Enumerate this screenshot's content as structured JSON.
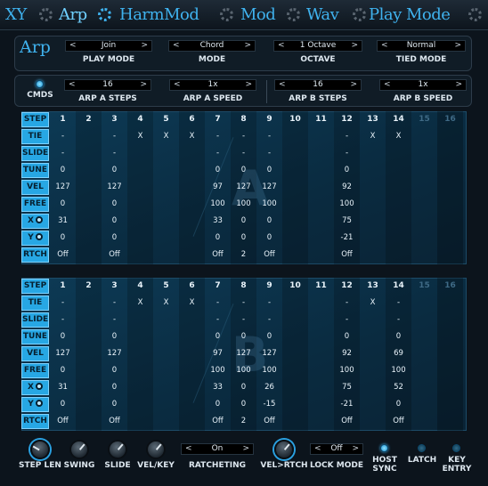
{
  "tabs": [
    {
      "label": "XY",
      "active": false
    },
    {
      "label": "Arp",
      "active": true
    },
    {
      "label": "HarmMod",
      "active": false
    },
    {
      "label": "Mod",
      "active": false
    },
    {
      "label": "Wav",
      "active": false
    },
    {
      "label": "Play Mode",
      "active": false
    }
  ],
  "arp": {
    "title": "Arp",
    "play_mode": {
      "label": "PLAY MODE",
      "value": "Join"
    },
    "mode": {
      "label": "MODE",
      "value": "Chord"
    },
    "octave": {
      "label": "OCTAVE",
      "value": "1 Octave"
    },
    "tied_mode": {
      "label": "TIED MODE",
      "value": "Normal"
    },
    "cmds_label": "CMDS",
    "arp_a_steps": {
      "label": "ARP A STEPS",
      "value": "16"
    },
    "arp_a_speed": {
      "label": "ARP A SPEED",
      "value": "1x"
    },
    "arp_b_steps": {
      "label": "ARP B STEPS",
      "value": "16"
    },
    "arp_b_speed": {
      "label": "ARP B SPEED",
      "value": "1x"
    },
    "arrow_left": "<",
    "arrow_right": ">"
  },
  "grid_a": {
    "letter": "A",
    "row_labels": [
      "STEP",
      "TIE",
      "SLIDE",
      "TUNE",
      "VEL",
      "FREE",
      "X",
      "Y",
      "RTCH"
    ],
    "active_steps": 14,
    "rows": [
      [
        "1",
        "2",
        "3",
        "4",
        "5",
        "6",
        "7",
        "8",
        "9",
        "10",
        "11",
        "12",
        "13",
        "14",
        "15",
        "16"
      ],
      [
        "-",
        "",
        "-",
        "X",
        "X",
        "X",
        "-",
        "-",
        "-",
        "",
        "",
        "-",
        "X",
        "X",
        "",
        ""
      ],
      [
        "-",
        "",
        "-",
        "",
        "",
        "",
        "-",
        "-",
        "-",
        "",
        "",
        "-",
        "",
        "",
        "",
        ""
      ],
      [
        "0",
        "",
        "0",
        "",
        "",
        "",
        "0",
        "0",
        "0",
        "",
        "",
        "0",
        "",
        "",
        "",
        ""
      ],
      [
        "127",
        "",
        "127",
        "",
        "",
        "",
        "97",
        "127",
        "127",
        "",
        "",
        "92",
        "",
        "",
        "",
        ""
      ],
      [
        "0",
        "",
        "0",
        "",
        "",
        "",
        "100",
        "100",
        "100",
        "",
        "",
        "100",
        "",
        "",
        "",
        ""
      ],
      [
        "31",
        "",
        "0",
        "",
        "",
        "",
        "33",
        "0",
        "0",
        "",
        "",
        "75",
        "",
        "",
        "",
        ""
      ],
      [
        "0",
        "",
        "0",
        "",
        "",
        "",
        "0",
        "0",
        "0",
        "",
        "",
        "-21",
        "",
        "",
        "",
        ""
      ],
      [
        "Off",
        "",
        "Off",
        "",
        "",
        "",
        "Off",
        "2",
        "Off",
        "",
        "",
        "Off",
        "",
        "",
        "",
        ""
      ]
    ]
  },
  "grid_b": {
    "letter": "B",
    "row_labels": [
      "STEP",
      "TIE",
      "SLIDE",
      "TUNE",
      "VEL",
      "FREE",
      "X",
      "Y",
      "RTCH"
    ],
    "active_steps": 14,
    "rows": [
      [
        "1",
        "2",
        "3",
        "4",
        "5",
        "6",
        "7",
        "8",
        "9",
        "10",
        "11",
        "12",
        "13",
        "14",
        "15",
        "16"
      ],
      [
        "-",
        "",
        "-",
        "X",
        "X",
        "X",
        "-",
        "-",
        "-",
        "",
        "",
        "-",
        "X",
        "-",
        "",
        ""
      ],
      [
        "-",
        "",
        "-",
        "",
        "",
        "",
        "-",
        "-",
        "-",
        "",
        "",
        "-",
        "",
        "-",
        "",
        ""
      ],
      [
        "0",
        "",
        "0",
        "",
        "",
        "",
        "0",
        "0",
        "0",
        "",
        "",
        "0",
        "",
        "0",
        "",
        ""
      ],
      [
        "127",
        "",
        "127",
        "",
        "",
        "",
        "97",
        "127",
        "127",
        "",
        "",
        "92",
        "",
        "69",
        "",
        ""
      ],
      [
        "0",
        "",
        "0",
        "",
        "",
        "",
        "100",
        "100",
        "100",
        "",
        "",
        "100",
        "",
        "100",
        "",
        ""
      ],
      [
        "31",
        "",
        "0",
        "",
        "",
        "",
        "33",
        "0",
        "26",
        "",
        "",
        "75",
        "",
        "52",
        "",
        ""
      ],
      [
        "0",
        "",
        "0",
        "",
        "",
        "",
        "0",
        "0",
        "-15",
        "",
        "",
        "-21",
        "",
        "0",
        "",
        ""
      ],
      [
        "Off",
        "",
        "Off",
        "",
        "",
        "",
        "Off",
        "2",
        "Off",
        "",
        "",
        "Off",
        "",
        "Off",
        "",
        ""
      ]
    ]
  },
  "bottom": {
    "step_len": "STEP LEN",
    "swing": "SWING",
    "slide": "SLIDE",
    "vel_key": "VEL/KEY",
    "ratcheting": {
      "label": "RATCHETING",
      "value": "On"
    },
    "vel_rtch": "VEL>RTCH",
    "lock_mode": {
      "label": "LOCK MODE",
      "value": "Off"
    },
    "host_sync": {
      "label_1": "HOST",
      "label_2": "SYNC",
      "on": true
    },
    "latch": {
      "label": "LATCH",
      "on": false
    },
    "key_entry": {
      "label_1": "KEY",
      "label_2": "ENTRY",
      "on": false
    }
  },
  "colors": {
    "accent": "#3fb2ee",
    "grid_bg": "#0a2b40",
    "row_label_bg": "#27a7e4"
  }
}
